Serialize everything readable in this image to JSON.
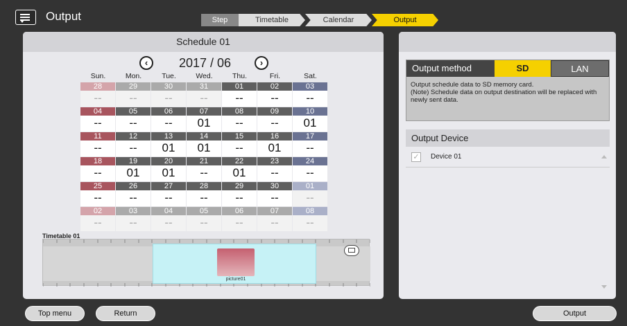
{
  "header": {
    "title": "Output"
  },
  "steps": {
    "label": "Step",
    "items": [
      {
        "label": "Timetable",
        "active": false
      },
      {
        "label": "Calendar",
        "active": false
      },
      {
        "label": "Output",
        "active": true
      }
    ]
  },
  "schedule": {
    "title": "Schedule 01",
    "month": "2017 / 06",
    "weekdays": [
      "Sun.",
      "Mon.",
      "Tue.",
      "Wed.",
      "Thu.",
      "Fri.",
      "Sat."
    ],
    "weeks": [
      [
        {
          "d": "28",
          "v": "--",
          "o": true
        },
        {
          "d": "29",
          "v": "--",
          "o": true
        },
        {
          "d": "30",
          "v": "--",
          "o": true
        },
        {
          "d": "31",
          "v": "--",
          "o": true
        },
        {
          "d": "01",
          "v": "--"
        },
        {
          "d": "02",
          "v": "--"
        },
        {
          "d": "03",
          "v": "--"
        }
      ],
      [
        {
          "d": "04",
          "v": "--"
        },
        {
          "d": "05",
          "v": "--"
        },
        {
          "d": "06",
          "v": "--"
        },
        {
          "d": "07",
          "v": "01"
        },
        {
          "d": "08",
          "v": "--"
        },
        {
          "d": "09",
          "v": "--"
        },
        {
          "d": "10",
          "v": "01"
        }
      ],
      [
        {
          "d": "11",
          "v": "--"
        },
        {
          "d": "12",
          "v": "--"
        },
        {
          "d": "13",
          "v": "01"
        },
        {
          "d": "14",
          "v": "01"
        },
        {
          "d": "15",
          "v": "--"
        },
        {
          "d": "16",
          "v": "01"
        },
        {
          "d": "17",
          "v": "--"
        }
      ],
      [
        {
          "d": "18",
          "v": "--"
        },
        {
          "d": "19",
          "v": "01"
        },
        {
          "d": "20",
          "v": "01"
        },
        {
          "d": "21",
          "v": "--"
        },
        {
          "d": "22",
          "v": "01"
        },
        {
          "d": "23",
          "v": "--"
        },
        {
          "d": "24",
          "v": "--"
        }
      ],
      [
        {
          "d": "25",
          "v": "--"
        },
        {
          "d": "26",
          "v": "--"
        },
        {
          "d": "27",
          "v": "--"
        },
        {
          "d": "28",
          "v": "--"
        },
        {
          "d": "29",
          "v": "--"
        },
        {
          "d": "30",
          "v": "--"
        },
        {
          "d": "01",
          "v": "--",
          "o": true
        }
      ],
      [
        {
          "d": "02",
          "v": "--",
          "o": true
        },
        {
          "d": "03",
          "v": "--",
          "o": true
        },
        {
          "d": "04",
          "v": "--",
          "o": true
        },
        {
          "d": "05",
          "v": "--",
          "o": true
        },
        {
          "d": "06",
          "v": "--",
          "o": true
        },
        {
          "d": "07",
          "v": "--",
          "o": true
        },
        {
          "d": "08",
          "v": "--",
          "o": true
        }
      ]
    ],
    "timetable_label": "Timetable 01",
    "picture_label": "picture01"
  },
  "colors": {
    "sun": "#a8555e",
    "sun_other": "#d4a4aa",
    "wk": "#5f5f5f",
    "wk_other": "#aaaaaa",
    "sat": "#6a7292",
    "sat_other": "#aab0c8"
  },
  "output": {
    "method_label": "Output method",
    "sd_label": "SD",
    "lan_label": "LAN",
    "description": "Output schedule data to SD memory card.\n(Note) Schedule data on output destination will be replaced with newly sent data.",
    "device_header": "Output Device",
    "devices": [
      "Device 01"
    ]
  },
  "footer": {
    "top_menu": "Top menu",
    "return": "Return",
    "output": "Output"
  }
}
